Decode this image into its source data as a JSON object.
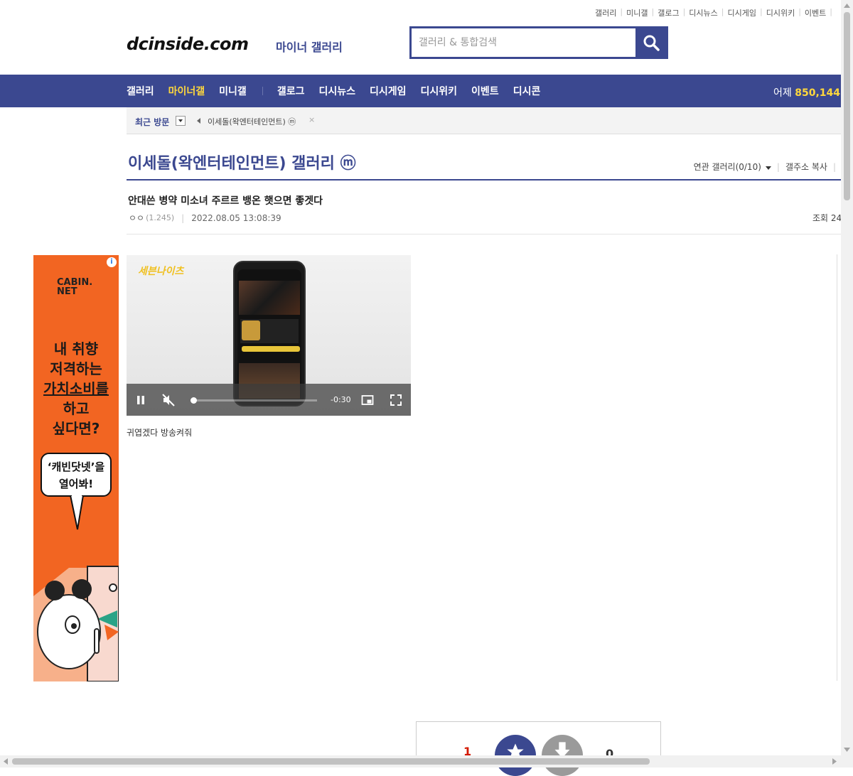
{
  "top_links": [
    "갤러리",
    "미니갤",
    "갤로그",
    "디시뉴스",
    "디시게임",
    "디시위키",
    "이벤트"
  ],
  "logo": {
    "text": "dcinside.com",
    "sub": "마이너 갤러리"
  },
  "search": {
    "placeholder": "갤러리 & 통합검색"
  },
  "nav": {
    "items": [
      {
        "label": "갤러리",
        "active": false
      },
      {
        "label": "마이너갤",
        "active": true
      },
      {
        "label": "미니갤",
        "active": false
      },
      {
        "label": "갤로그",
        "active": false
      },
      {
        "label": "디시뉴스",
        "active": false
      },
      {
        "label": "디시게임",
        "active": false
      },
      {
        "label": "디시위키",
        "active": false
      },
      {
        "label": "이벤트",
        "active": false
      },
      {
        "label": "디시콘",
        "active": false
      }
    ],
    "yesterday_label": "어제",
    "yesterday_value": "850,144"
  },
  "recent": {
    "label": "최근 방문",
    "item": "이세돌(왁엔터테인먼트)",
    "item_badge": "ⓜ",
    "close": "×"
  },
  "gallery": {
    "title": "이세돌(왁엔터테인먼트) 갤러리",
    "badge": "ⓜ",
    "related": "연관 갤러리(0/10)",
    "copy_addr": "갤주소 복사"
  },
  "post": {
    "title": "안대쓴 병약 미소녀 주르르 뱅온 햇으면 좋겟다",
    "author": "ㅇㅇ",
    "ip": "(1.245)",
    "date": "2022.08.05 13:08:39",
    "views_label": "조회 24",
    "body": "귀엽겠다 방송켜줘"
  },
  "ad": {
    "brand_line1": "CABIN.",
    "brand_line2": "NET",
    "copy": [
      "내 취향",
      "저격하는",
      "가치소비를",
      "하고",
      "싶다면?"
    ],
    "bubble_line1": "‘캐빈닷넷’을",
    "bubble_line2": "열어봐!",
    "info": "i"
  },
  "video": {
    "logo": "세븐나이츠",
    "time": "-0:30",
    "progress": 0.02,
    "muted": true
  },
  "recommend": {
    "up_count": "1",
    "down_count": "0"
  },
  "colors": {
    "brand": "#3b4890",
    "active_nav": "#ffd83c",
    "ad_orange": "#f26522",
    "up_count": "#d31900"
  }
}
